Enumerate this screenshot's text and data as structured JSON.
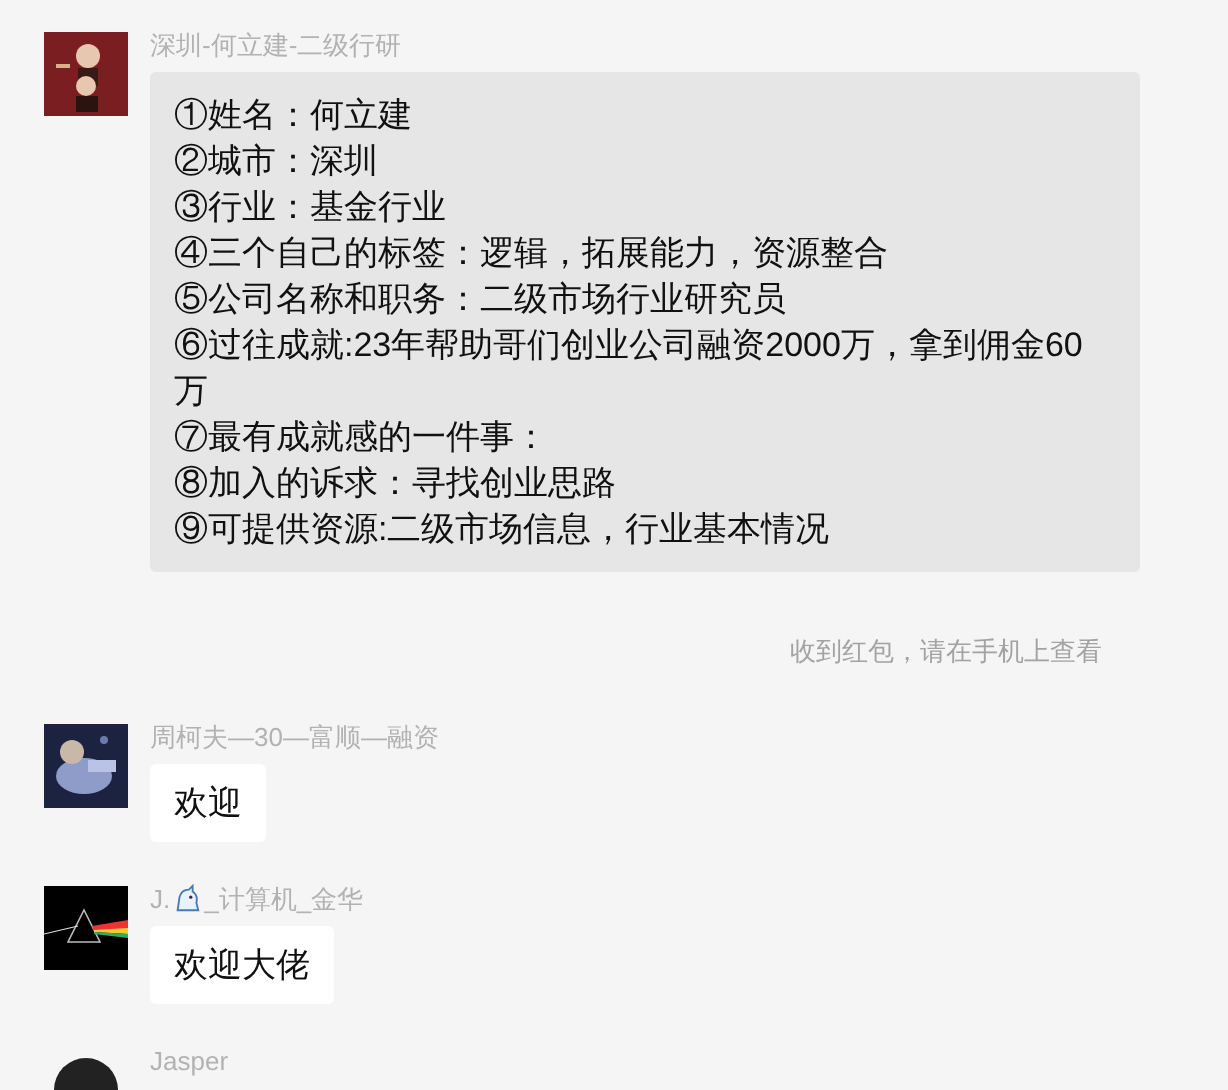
{
  "messages": [
    {
      "kind": "message",
      "sender": "深圳-何立建-二级行研",
      "highlighted": true,
      "lines": [
        "①姓名：何立建",
        "②城市：深圳",
        "③行业：基金行业",
        "④三个自己的标签：逻辑，拓展能力，资源整合",
        "⑤公司名称和职务：二级市场行业研究员",
        "⑥过往成就:23年帮助哥们创业公司融资2000万，拿到佣金60万",
        "⑦最有成就感的一件事：",
        "⑧加入的诉求：寻找创业思路",
        "⑨可提供资源:二级市场信息，行业基本情况"
      ]
    },
    {
      "kind": "notice",
      "text": "收到红包，请在手机上查看"
    },
    {
      "kind": "message",
      "sender": "周柯夫—30—富顺—融资",
      "highlighted": false,
      "lines": [
        "欢迎"
      ]
    },
    {
      "kind": "message",
      "sender": "J.",
      "sender_suffix": "_计算机_金华",
      "highlighted": false,
      "lines": [
        "欢迎大佬"
      ]
    },
    {
      "kind": "message",
      "sender": "Jasper"
    }
  ]
}
